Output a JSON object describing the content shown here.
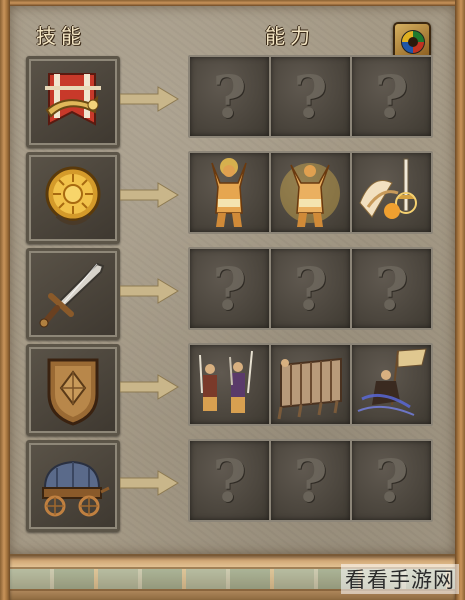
{
  "header": {
    "skills_label": "技能",
    "abilities_label": "能力"
  },
  "settings_icon": "color-wheel-icon",
  "rows": [
    {
      "skill_icon": "horn-banner-icon",
      "abilities": [
        "unknown-icon",
        "unknown-icon",
        "unknown-icon"
      ]
    },
    {
      "skill_icon": "sun-medallion-icon",
      "abilities": [
        "angel-figure-icon",
        "radiant-figure-icon",
        "winged-sword-icon"
      ]
    },
    {
      "skill_icon": "sword-icon",
      "abilities": [
        "unknown-icon",
        "unknown-icon",
        "unknown-icon"
      ]
    },
    {
      "skill_icon": "shield-icon",
      "abilities": [
        "swordsmen-icon",
        "shield-wall-icon",
        "charging-warrior-icon"
      ]
    },
    {
      "skill_icon": "supply-wagon-icon",
      "abilities": [
        "unknown-icon",
        "unknown-icon",
        "unknown-icon"
      ]
    }
  ],
  "unknown_glyph": "?",
  "watermark": "看看手游网",
  "colors": {
    "panel": "#a59a86",
    "slot_border": "#8c8578",
    "arrow": "#c9b68a",
    "header_text": "#f4e6c4"
  }
}
